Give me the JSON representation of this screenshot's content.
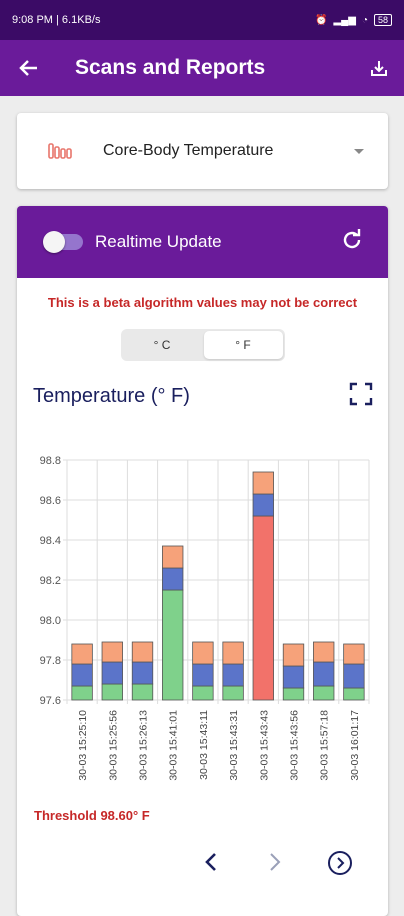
{
  "status": {
    "time_speed": "9:08 PM | 6.1KB/s",
    "battery": "58"
  },
  "appbar": {
    "title": "Scans and Reports"
  },
  "selector": {
    "label": "Core-Body Temperature"
  },
  "header": {
    "realtime_label": "Realtime Update"
  },
  "beta_warning": "This is a beta algorithm values may not be correct",
  "unit_toggle": {
    "celsius": "° C",
    "fahrenheit": "° F",
    "selected": "fahrenheit"
  },
  "chart_header": {
    "title": "Temperature (° F)"
  },
  "threshold": "Threshold 98.60° F",
  "colors": {
    "primary": "#6a1b9a",
    "green": "#7fd18b",
    "blue": "#5b74c9",
    "orange": "#f6a27a",
    "red": "#f2726a"
  },
  "chart_data": {
    "type": "bar",
    "stacked": true,
    "title": "Temperature (° F)",
    "ylim": [
      97.6,
      98.8
    ],
    "yticks": [
      "97.6",
      "97.8",
      "98.0",
      "98.2",
      "98.4",
      "98.6",
      "98.8"
    ],
    "categories": [
      "30-03 15:25:10",
      "30-03 15:25:56",
      "30-03 15:26:13",
      "30-03 15:41:01",
      "30-03 15:43:11",
      "30-03 15:43:31",
      "30-03 15:43:43",
      "30-03 15:43:56",
      "30-03 15:57:18",
      "30-03 16:01:17"
    ],
    "series": [
      {
        "color": "green",
        "values": [
          97.67,
          97.68,
          97.68,
          98.15,
          97.67,
          97.67,
          0,
          97.66,
          97.67,
          97.66
        ]
      },
      {
        "color": "red",
        "values": [
          0,
          0,
          0,
          0,
          0,
          0,
          98.52,
          0,
          0,
          0
        ]
      },
      {
        "color": "blue",
        "values": [
          97.78,
          97.79,
          97.79,
          98.26,
          97.78,
          97.78,
          98.63,
          97.77,
          97.79,
          97.78
        ]
      },
      {
        "color": "orange",
        "values": [
          97.88,
          97.89,
          97.89,
          98.37,
          97.89,
          97.89,
          98.74,
          97.88,
          97.89,
          97.88
        ]
      }
    ]
  }
}
